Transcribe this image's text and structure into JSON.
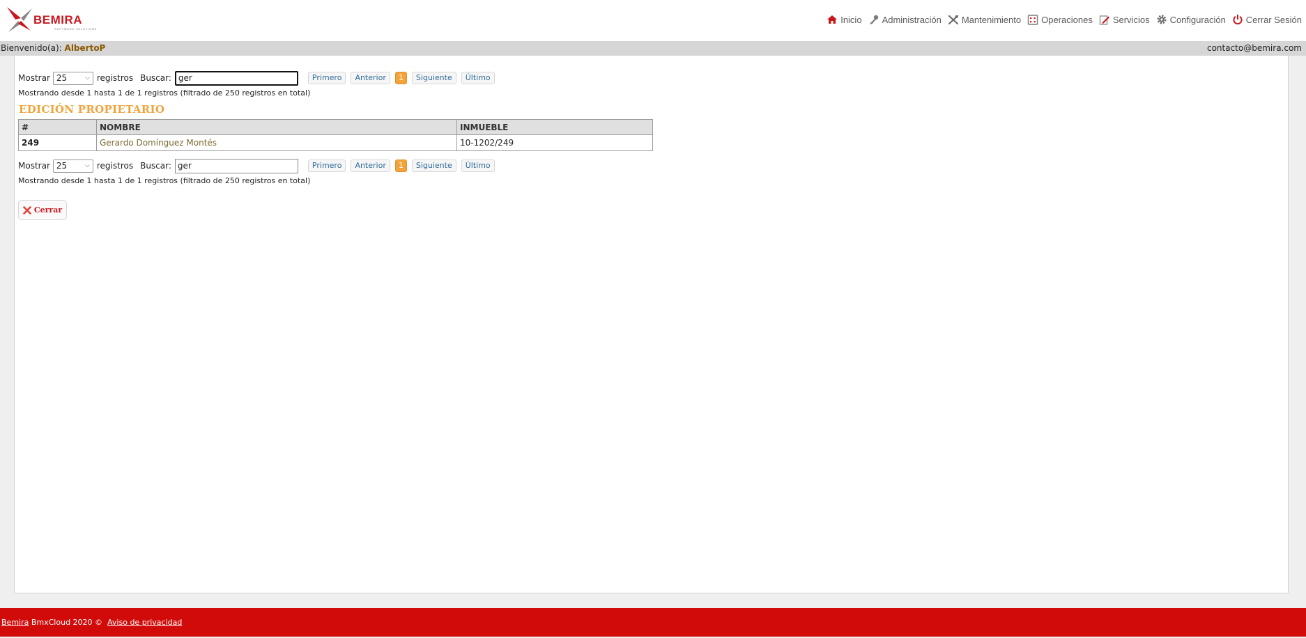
{
  "brand": {
    "name": "BEMIRA",
    "tagline": "SOFTWARE SOLUTIONS",
    "accent": "#c8161d"
  },
  "nav": [
    {
      "label": "Inicio",
      "icon": "home-icon"
    },
    {
      "label": "Administración",
      "icon": "key-icon"
    },
    {
      "label": "Mantenimiento",
      "icon": "tools-icon"
    },
    {
      "label": "Operaciones",
      "icon": "calculator-icon"
    },
    {
      "label": "Servicios",
      "icon": "edit-icon"
    },
    {
      "label": "Configuración",
      "icon": "gear-icon"
    },
    {
      "label": "Cerrar Sesión",
      "icon": "power-icon"
    }
  ],
  "welcome": {
    "prefix": "Bienvenido(a):",
    "user": "AlbertoP",
    "contact": "contacto@bemira.com"
  },
  "top_controls": {
    "show_label": "Mostrar",
    "page_size": "25",
    "records_label": "registros",
    "search_label": "Buscar:",
    "search_value": "ger",
    "pager": {
      "first": "Primero",
      "prev": "Anterior",
      "current": "1",
      "next": "Siguiente",
      "last": "Último"
    },
    "info": "Mostrando desde 1 hasta 1 de 1 registros (filtrado de 250 registros en total)"
  },
  "section_title": "EDICIÓN PROPIETARIO",
  "table": {
    "columns": [
      "#",
      "NOMBRE",
      "INMUEBLE"
    ],
    "rows": [
      {
        "id": "249",
        "name": "Gerardo Domínguez Montés",
        "property": "10-1202/249"
      }
    ]
  },
  "bottom_controls": {
    "show_label": "Mostrar",
    "page_size": "25",
    "records_label": "registros",
    "search_label": "Buscar:",
    "search_value": "ger",
    "pager": {
      "first": "Primero",
      "prev": "Anterior",
      "current": "1",
      "next": "Siguiente",
      "last": "Último"
    },
    "info": "Mostrando desde 1 hasta 1 de 1 registros (filtrado de 250 registros en total)"
  },
  "close_button": {
    "label": "Cerrar",
    "icon": "close-icon"
  },
  "footer": {
    "brand_link": "Bemira",
    "copyright": "BmxCloud 2020 ©",
    "privacy_link": "Aviso de privacidad",
    "color": "#d10a0a"
  }
}
